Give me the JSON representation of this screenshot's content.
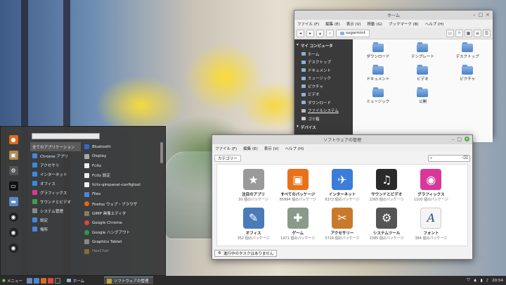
{
  "file_manager": {
    "title": "ホーム",
    "menu": [
      "ファイル (F)",
      "編集 (E)",
      "表示 (V)",
      "移動 (G)",
      "ブックマーク (B)",
      "ヘルプ (H)"
    ],
    "path": "sugarmint",
    "sidebar": {
      "section_computer": "マイ コンピュータ",
      "items": [
        "ホーム",
        "デスクトップ",
        "ドキュメント",
        "ミュージック",
        "ピクチャ",
        "ビデオ",
        "ダウンロード",
        "ファイルシステム",
        "ゴミ箱"
      ],
      "section_devices": "デバイス"
    },
    "files": [
      "ダウンロード",
      "テンプレート",
      "デスクトップ",
      "ドキュメント",
      "ビデオ",
      "ピクチャ",
      "ミュージック",
      "公開"
    ]
  },
  "software_manager": {
    "title": "ソフトウェアの管理",
    "menu": [
      "ファイル (F)",
      "編集 (E)",
      "表示 (V)",
      "ヘルプ (H)"
    ],
    "category_button": "カテゴリー",
    "categories": [
      {
        "label": "注目のアプリ",
        "count": "30 個のパッケージ",
        "color": "#9a9a9a",
        "glyph": "★"
      },
      {
        "label": "すべてのパッケージ",
        "count": "85894 個のパッケージ",
        "color": "#e8711a",
        "glyph": "▣"
      },
      {
        "label": "インターネット",
        "count": "6372 個のパッケージ",
        "color": "#3b7dd8",
        "glyph": "✈"
      },
      {
        "label": "サウンドとビデオ",
        "count": "2365 個のパッケージ",
        "color": "#2a2a2a",
        "glyph": "♫"
      },
      {
        "label": "グラフィックス",
        "count": "1100 個のパッケージ",
        "color": "#d8389a",
        "glyph": "◉"
      },
      {
        "label": "オフィス",
        "count": "352 個のパッケージ",
        "color": "#4a7ab8",
        "glyph": "✎"
      },
      {
        "label": "ゲーム",
        "count": "1971 個のパッケージ",
        "color": "#8a9a8a",
        "glyph": "✚"
      },
      {
        "label": "アクセサリー",
        "count": "5724 個のパッケージ",
        "color": "#c87a2a",
        "glyph": "✂"
      },
      {
        "label": "システムツール",
        "count": "3385 個のパッケージ",
        "color": "#555555",
        "glyph": "⚙"
      },
      {
        "label": "フォント",
        "count": "384 個のパッケージ",
        "color": "#f4f4f4",
        "glyph": "A"
      }
    ],
    "status": "進行中のタスクはありません"
  },
  "start_menu": {
    "categories": [
      "全てのアプリケーション",
      "Chrome アプリ",
      "アクセサリ",
      "インターネット",
      "オフィス",
      "グラフィックス",
      "サウンドとビデオ",
      "システム管理",
      "設定",
      "場所"
    ],
    "apps": [
      "Bluetooth",
      "Display",
      "Fcitx",
      "Fcitx 設定",
      "fcitx-qimpanel-configtool",
      "Files",
      "Firefox ウェブ・ブラウザ",
      "GIMP 画像エディタ",
      "Google Chrome",
      "Google ハングアウト",
      "Graphics Tablet",
      "HexChat"
    ]
  },
  "taskbar": {
    "menu_label": "メニュー",
    "windows": [
      "ホーム",
      "ソフトウェアの管理"
    ],
    "clock": "20:54"
  }
}
